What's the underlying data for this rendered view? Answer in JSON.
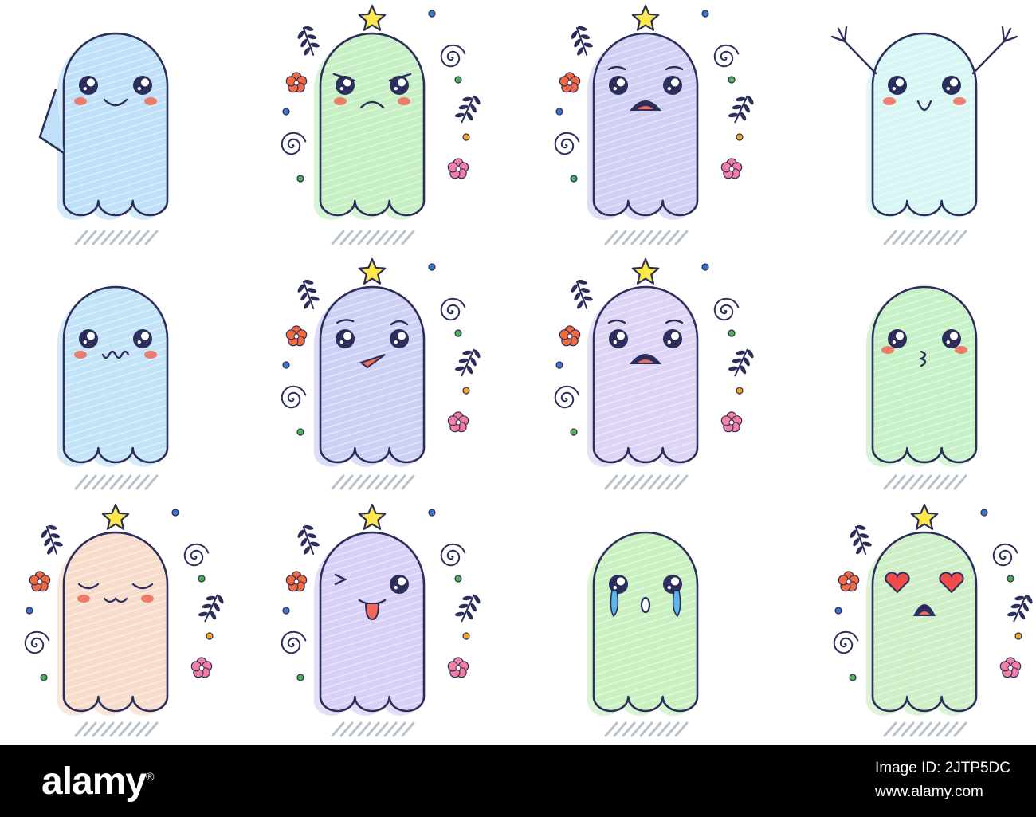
{
  "image": {
    "subject": "kawaii ghost emoji stickers",
    "count": 12,
    "outline_color": "#2b2d5a",
    "scribble_color": "#9aa8b6",
    "blush_color": "#f06a55",
    "star_color": "#ffe84a",
    "flower_orange": "#f26a3d",
    "flower_pink": "#f47fa2",
    "dot_blue": "#3a74c8",
    "dot_green": "#4caf50",
    "dot_orange": "#f5a623"
  },
  "ghosts": [
    {
      "body": "#bfe0f8",
      "expression": "smile-waving"
    },
    {
      "body": "#c6efc4",
      "expression": "frown-angry"
    },
    {
      "body": "#cfd0f4",
      "expression": "scared"
    },
    {
      "body": "#d8f6f4",
      "expression": "happy-arms-up"
    },
    {
      "body": "#c3e3f8",
      "expression": "wobbly-smile"
    },
    {
      "body": "#cdd0f4",
      "expression": "skeptical"
    },
    {
      "body": "#ddd3f4",
      "expression": "shocked"
    },
    {
      "body": "#c6f0c6",
      "expression": "kiss"
    },
    {
      "body": "#f8dccb",
      "expression": "content-eyes-closed"
    },
    {
      "body": "#d8d0f6",
      "expression": "wink-tongue"
    },
    {
      "body": "#c9f0c0",
      "expression": "crying"
    },
    {
      "body": "#cdeec6",
      "expression": "heart-eyes"
    }
  ],
  "watermark": {
    "logo": "alamy",
    "registered": "®",
    "image_id": "Image ID: 2JTP5DC",
    "url": "www.alamy.com"
  }
}
